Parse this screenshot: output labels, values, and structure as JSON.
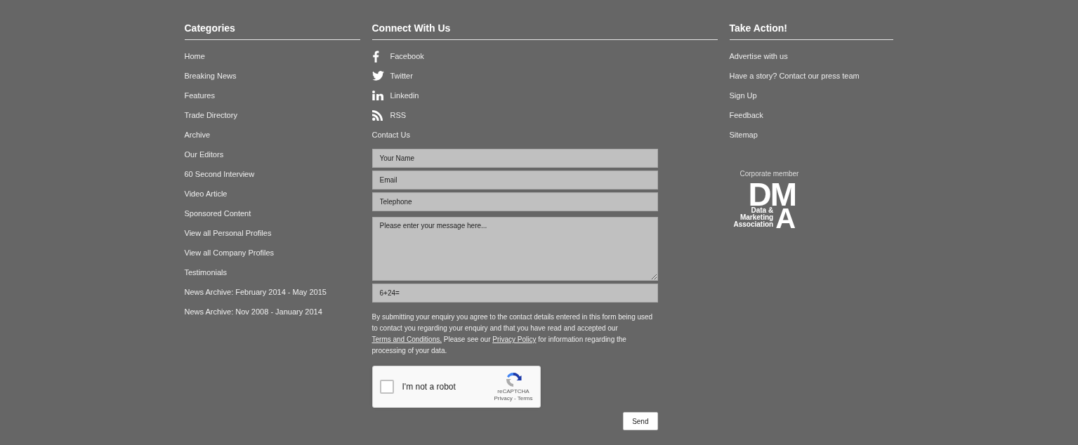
{
  "categories": {
    "title": "Categories",
    "links": [
      {
        "label": "Home"
      },
      {
        "label": "Breaking News"
      },
      {
        "label": "Features"
      },
      {
        "label": "Trade Directory"
      },
      {
        "label": "Archive"
      },
      {
        "label": "Our Editors"
      },
      {
        "label": "60 Second Interview"
      },
      {
        "label": "Video Article"
      },
      {
        "label": "Sponsored Content"
      },
      {
        "label": "View all Personal Profiles"
      },
      {
        "label": "View all Company Profiles"
      },
      {
        "label": "Testimonials"
      },
      {
        "label": "News Archive: February 2014 - May 2015"
      },
      {
        "label": "News Archive: Nov 2008 - January 2014"
      }
    ]
  },
  "connect": {
    "title": "Connect With Us",
    "social": [
      {
        "kind": "facebook",
        "label": "Facebook"
      },
      {
        "kind": "twitter",
        "label": "Twitter"
      },
      {
        "kind": "linkedin",
        "label": "Linkedin"
      },
      {
        "kind": "rss",
        "label": "RSS"
      }
    ],
    "contact_title": "Contact Us",
    "form": {
      "fields": [
        {
          "kind": "input",
          "placeholder": "Your Name"
        },
        {
          "kind": "input",
          "placeholder": "Email"
        },
        {
          "kind": "input",
          "placeholder": "Telephone"
        },
        {
          "kind": "textarea",
          "placeholder": "Please enter your message here..."
        },
        {
          "kind": "input",
          "placeholder": "6+24="
        }
      ],
      "consent": [
        {
          "kind": "text",
          "text": "By submitting your enquiry you agree to the contact details entered in this form being used to contact you regarding your enquiry and that you have read and accepted our "
        },
        {
          "kind": "link",
          "text": "Terms and Conditions."
        },
        {
          "kind": "text",
          "text": " Please see our "
        },
        {
          "kind": "link",
          "text": "Privacy Policy"
        },
        {
          "kind": "text",
          "text": " for information regarding the processing of your data."
        }
      ],
      "captcha": {
        "label": "I'm not a robot",
        "checked": false,
        "brand": "reCAPTCHA",
        "links": "Privacy - Terms"
      },
      "submit": "Send"
    }
  },
  "take_action": {
    "title": "Take Action!",
    "links": [
      {
        "label": "Advertise with us"
      },
      {
        "label": "Have a story? Contact our press team"
      },
      {
        "label": "Sign Up"
      },
      {
        "label": "Feedback"
      },
      {
        "label": "Sitemap"
      }
    ],
    "membership": {
      "caption": "Corporate member",
      "logo_top": "DM",
      "logo_bottom": "A",
      "logo_lines": [
        "Data &",
        "Marketing",
        "Association"
      ]
    }
  }
}
